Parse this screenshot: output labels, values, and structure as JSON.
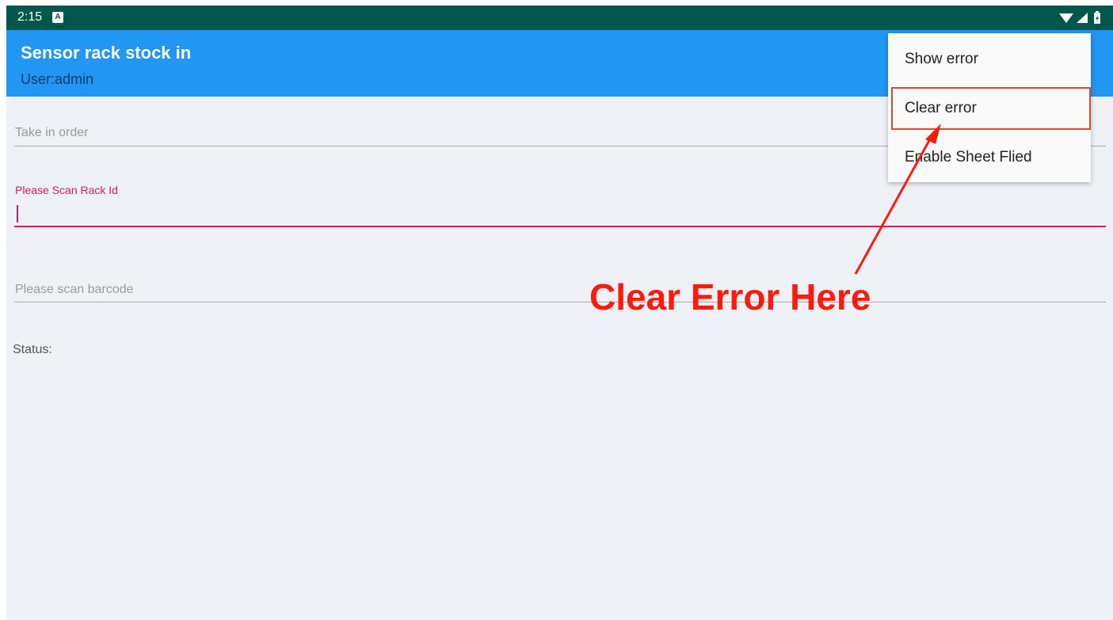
{
  "statusbar": {
    "time": "2:15",
    "notification_icon": "A"
  },
  "appbar": {
    "title": "Sensor rack stock in",
    "subtitle": "User:admin"
  },
  "form": {
    "take_in_order_hint": "Take in order",
    "rack_label": "Please Scan Rack Id",
    "rack_value": "",
    "barcode_hint": "Please scan barcode",
    "status_label": "Status:"
  },
  "menu": {
    "items": [
      {
        "label": "Show error"
      },
      {
        "label": "Clear error"
      },
      {
        "label": "Enable Sheet Flied"
      }
    ]
  },
  "annotation": {
    "text": "Clear Error Here",
    "color": "#ff1a0d"
  },
  "colors": {
    "statusbar": "#01574b",
    "appbar": "#2196f3",
    "accent": "#d81b60",
    "background": "#eef2f6"
  }
}
